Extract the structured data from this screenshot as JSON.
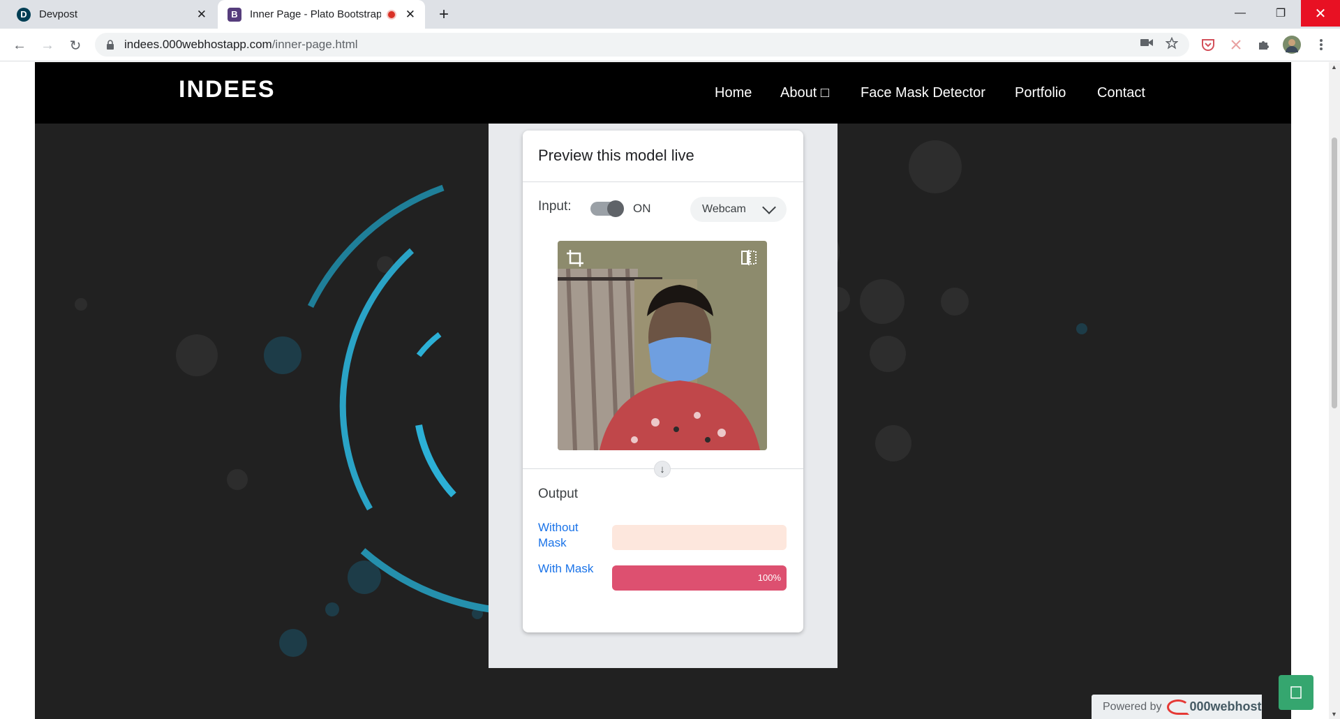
{
  "browser": {
    "tabs": [
      {
        "favicon": "D",
        "title": "Devpost",
        "close": "✕"
      },
      {
        "favicon": "B",
        "title": "Inner Page - Plato Bootstrap",
        "close": "✕"
      }
    ],
    "new_tab": "+",
    "window": {
      "minimize": "—",
      "maximize": "❐",
      "close": "✕"
    },
    "nav": {
      "back": "←",
      "forward": "→",
      "reload": "↻"
    },
    "url_host": "indees.000webhostapp.com",
    "url_path": "/inner-page.html"
  },
  "site": {
    "logo": "INDEES",
    "nav": [
      "Home",
      "About □",
      "Face Mask Detector",
      "Portfolio",
      "Contact"
    ]
  },
  "card": {
    "title": "Preview this model live",
    "input_label": "Input:",
    "toggle_state": "ON",
    "source": "Webcam",
    "output_title": "Output",
    "classes": [
      {
        "label": "Without Mask",
        "confidence": 0,
        "pct_text": ""
      },
      {
        "label": "With Mask",
        "confidence": 1.0,
        "pct_text": "100%"
      }
    ],
    "colors": {
      "bar_fill": "#dd5070",
      "bar_track": "#fde7dd",
      "label": "#1a73e8"
    }
  },
  "footer": {
    "powered_by": "Powered by",
    "brand": "000webhost",
    "chat_icon": "chat-icon"
  }
}
